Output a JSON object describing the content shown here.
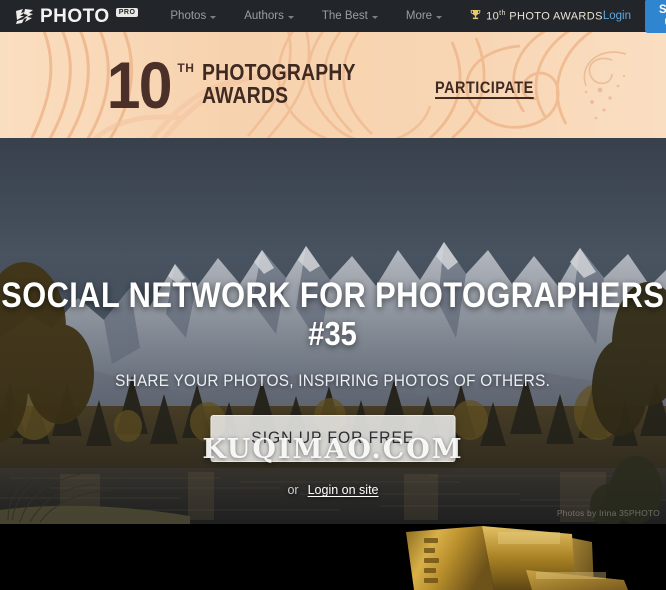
{
  "header": {
    "logo": {
      "mark_icon": "camera-abstract-icon",
      "text": "PHOTO",
      "badge": "PRO"
    },
    "nav": [
      {
        "label": "Photos",
        "has_caret": true
      },
      {
        "label": "Authors",
        "has_caret": true
      },
      {
        "label": "The Best",
        "has_caret": true
      },
      {
        "label": "More",
        "has_caret": true
      }
    ],
    "awards_link": {
      "icon": "trophy-icon",
      "ordinal": "10",
      "sup": "th",
      "label": "PHOTO AWARDS"
    },
    "login_label": "Login",
    "signup_label": "Sign up",
    "colors": {
      "bar_bg": "#22252a",
      "accent_blue": "#2f85d0",
      "link_blue": "#5fa8e0",
      "gold": "#e8c96a"
    }
  },
  "banner": {
    "number": "10",
    "ordinal_suffix": "TH",
    "line1": "PHOTOGRAPHY",
    "line2": "AWARDS",
    "participate_label": "PARTICIPATE",
    "colors": {
      "bg_light": "#fadec0",
      "bg_mid": "#f2b787",
      "text": "#3f2a22"
    }
  },
  "hero": {
    "headline": "SOCIAL NETWORK FOR PHOTOGRAPHERS",
    "headline_number": "#35",
    "tagline": "SHARE YOUR PHOTOS, INSPIRING PHOTOS OF OTHERS.",
    "cta_label": "SIGN UP FOR FREE",
    "or_label": "or",
    "login_site_label": "Login on site",
    "watermark": "KUQIMAO.COM",
    "photo_credit": "Photos by Irina 35PHOTO",
    "image_alt": "snow-capped-mountains-autumn-forest-river"
  },
  "footer": {
    "image_alt": "golden-award-trophy-plaque",
    "bg_color": "#000000"
  }
}
